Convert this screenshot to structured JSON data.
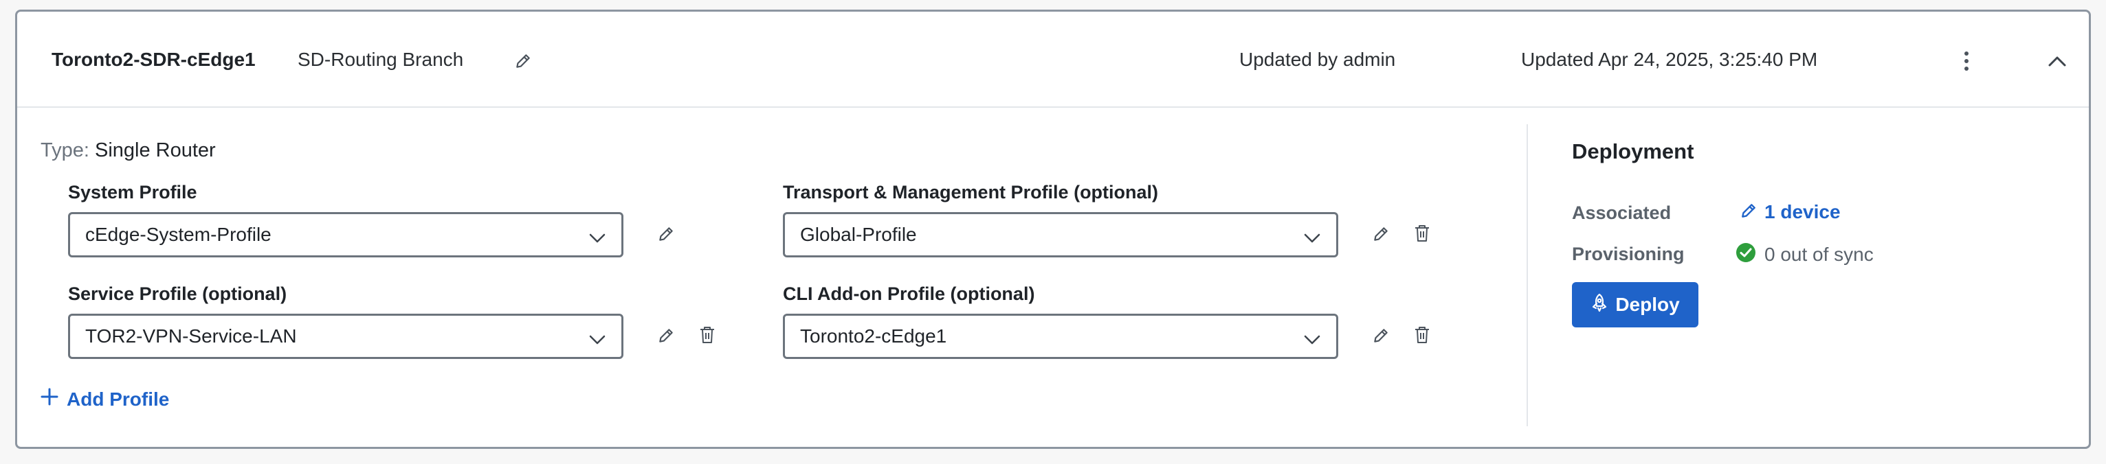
{
  "header": {
    "name": "Toronto2-SDR-cEdge1",
    "group": "SD-Routing Branch",
    "updated_by": "Updated by admin",
    "updated_at": "Updated Apr 24, 2025, 3:25:40 PM"
  },
  "type": {
    "key": "Type:",
    "value": "Single Router"
  },
  "profiles": {
    "system": {
      "label": "System Profile",
      "value": "cEdge-System-Profile"
    },
    "transport": {
      "label": "Transport & Management Profile (optional)",
      "value": "Global-Profile"
    },
    "service": {
      "label": "Service Profile (optional)",
      "value": "TOR2-VPN-Service-LAN"
    },
    "cli": {
      "label": "CLI Add-on Profile (optional)",
      "value": "Toronto2-cEdge1"
    }
  },
  "add_profile_label": "Add Profile",
  "deployment": {
    "title": "Deployment",
    "associated_label": "Associated",
    "associated_value": "1 device",
    "provisioning_label": "Provisioning",
    "provisioning_value": "0 out of sync",
    "deploy_label": "Deploy"
  },
  "colors": {
    "accent": "#1f63c9",
    "success": "#2e9e3c",
    "border": "#8d96a1"
  },
  "icons": [
    "pencil-icon",
    "trash-icon",
    "chevron-down-icon",
    "chevron-up-icon",
    "kebab-menu-icon",
    "plus-icon",
    "check-circle-icon",
    "rocket-icon"
  ]
}
